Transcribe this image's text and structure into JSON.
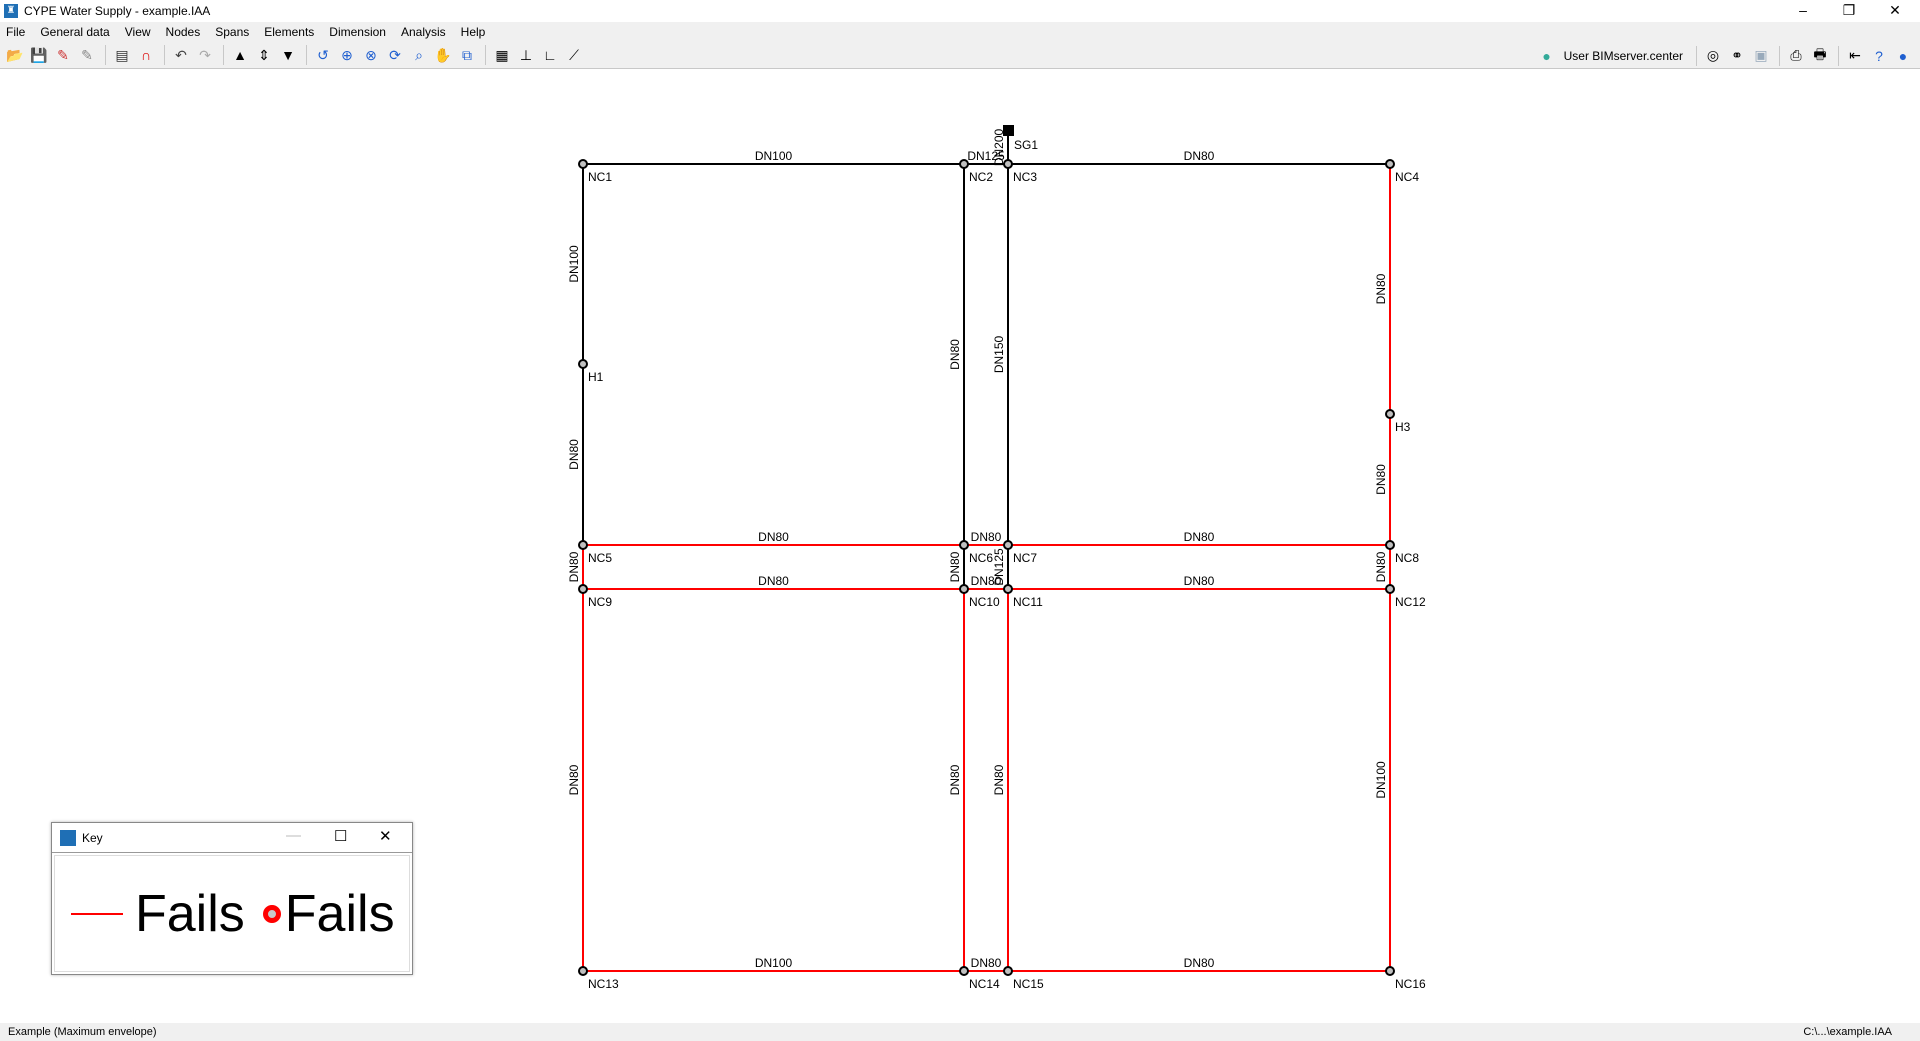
{
  "window": {
    "title": "CYPE Water Supply - example.IAA",
    "minimize": "–",
    "restore": "❐",
    "close": "✕"
  },
  "menu": [
    "File",
    "General data",
    "View",
    "Nodes",
    "Spans",
    "Elements",
    "Dimension",
    "Analysis",
    "Help"
  ],
  "toolbar": {
    "left_icons": [
      "open-folder",
      "save",
      "edit-colors",
      "edit-colors-disabled",
      "sep",
      "dxf-dwg",
      "magnet",
      "sep",
      "undo",
      "redo",
      "sep",
      "arrow-up",
      "expand-vertical",
      "arrow-down",
      "sep",
      "zoom-previous",
      "zoom-all",
      "zoom-x2",
      "redraw",
      "zoom-window",
      "pan-hand",
      "view-window",
      "sep",
      "find",
      "axes",
      "angle",
      "dimension-line"
    ],
    "user": "User BIMserver.center"
  },
  "colors": {
    "fails": "#ff0000",
    "ok": "#000000",
    "node_fill": "#c0c0c0"
  },
  "network": {
    "source": {
      "id": "SG1"
    },
    "nodes": [
      "NC1",
      "NC2",
      "NC3",
      "NC4",
      "H1",
      "H3",
      "NC5",
      "NC6",
      "NC7",
      "NC8",
      "NC9",
      "NC10",
      "NC11",
      "NC12",
      "NC13",
      "NC14",
      "NC15",
      "NC16"
    ],
    "segments": [
      {
        "from": "SG1",
        "to": "NC3",
        "label": "DN200",
        "status": "ok"
      },
      {
        "from": "NC1",
        "to": "NC2",
        "label": "DN100",
        "status": "ok"
      },
      {
        "from": "NC2",
        "to": "NC3",
        "label": "DN125",
        "status": "ok"
      },
      {
        "from": "NC3",
        "to": "NC4",
        "label": "DN80",
        "status": "ok"
      },
      {
        "from": "NC1",
        "to": "H1",
        "label": "DN100",
        "status": "ok"
      },
      {
        "from": "H1",
        "to": "NC5",
        "label": "DN80",
        "status": "ok"
      },
      {
        "from": "NC2",
        "to": "NC6",
        "label": "DN80",
        "status": "ok"
      },
      {
        "from": "NC3",
        "to": "NC7",
        "label": "DN150",
        "status": "ok"
      },
      {
        "from": "NC4",
        "to": "H3",
        "label": "DN80",
        "status": "fails"
      },
      {
        "from": "H3",
        "to": "NC8",
        "label": "DN80",
        "status": "fails"
      },
      {
        "from": "NC5",
        "to": "NC6",
        "label": "DN80",
        "status": "fails"
      },
      {
        "from": "NC6",
        "to": "NC7",
        "label": "DN80",
        "status": "fails"
      },
      {
        "from": "NC7",
        "to": "NC8",
        "label": "DN80",
        "status": "fails"
      },
      {
        "from": "NC5",
        "to": "NC9",
        "label": "DN80",
        "status": "fails"
      },
      {
        "from": "NC6",
        "to": "NC10",
        "label": "DN80",
        "status": "ok"
      },
      {
        "from": "NC7",
        "to": "NC11",
        "label": "DN125",
        "status": "ok"
      },
      {
        "from": "NC8",
        "to": "NC12",
        "label": "DN80",
        "status": "fails"
      },
      {
        "from": "NC9",
        "to": "NC10",
        "label": "DN80",
        "status": "fails"
      },
      {
        "from": "NC10",
        "to": "NC11",
        "label": "DN80",
        "status": "fails"
      },
      {
        "from": "NC11",
        "to": "NC12",
        "label": "DN80",
        "status": "fails"
      },
      {
        "from": "NC9",
        "to": "NC13",
        "label": "DN80",
        "status": "fails"
      },
      {
        "from": "NC10",
        "to": "NC14",
        "label": "DN80",
        "status": "fails"
      },
      {
        "from": "NC11",
        "to": "NC15",
        "label": "DN80",
        "status": "fails"
      },
      {
        "from": "NC12",
        "to": "NC16",
        "label": "DN100",
        "status": "fails"
      },
      {
        "from": "NC13",
        "to": "NC14",
        "label": "DN100",
        "status": "fails"
      },
      {
        "from": "NC14",
        "to": "NC15",
        "label": "DN80",
        "status": "fails"
      },
      {
        "from": "NC15",
        "to": "NC16",
        "label": "DN80",
        "status": "fails"
      }
    ]
  },
  "key": {
    "title": "Key",
    "span_label": "Fails",
    "node_label": "Fails",
    "minimize": "—",
    "maximize": "☐",
    "close": "✕"
  },
  "status": {
    "left": "Example (Maximum envelope)",
    "right": "C:\\...\\example.IAA"
  }
}
